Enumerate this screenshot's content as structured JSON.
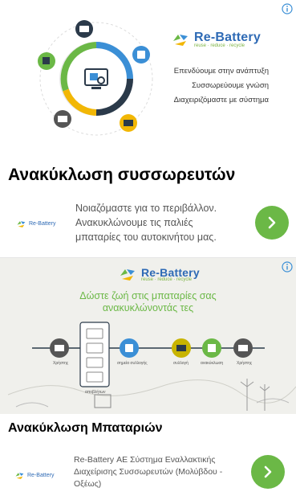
{
  "ads": [
    {
      "brand": {
        "name": "Re-Battery",
        "tagline": "reuse · reduce · recycle"
      },
      "creative_lines": [
        "Επενδύουμε στην ανάπτυξη",
        "Συσσωρεύουμε γνώση",
        "Διαχειριζόμαστε με σύστημα"
      ],
      "headline": "Ανακύκλωση συσσωρευτών",
      "sponsor": "Re-Battery",
      "description": "Νοιαζόμαστε για το περιβάλλον. Ανακυκλώνουμε τις παλιές μπαταρίες του αυτοκινήτου μας.",
      "cta_icon": "chevron-right-icon"
    },
    {
      "brand": {
        "name": "Re-Battery",
        "tagline": "reuse · reduce · recycle"
      },
      "creative_headline_1": "Δώστε ζωή στις μπαταρίες σας",
      "creative_headline_2": "ανακυκλώνοντάς τες",
      "flow_labels": [
        "Χρήστης",
        "σημεία συλλογής",
        "συλλογή",
        "ανακύκλωση",
        "Χρήστης",
        "αποβλήτων"
      ],
      "headline": "Ανακύκλωση Μπαταριών",
      "sponsor": "Re-Battery",
      "description": "Re-Battery ΑΕ Σύστημα Εναλλακτικής Διαχείρισης Συσσωρευτών (Μολύβδου - Οξέως)",
      "cta_icon": "chevron-right-icon"
    }
  ],
  "colors": {
    "brand_blue": "#2e6ab5",
    "brand_green": "#6bb846",
    "info_blue": "#3b8fd6"
  }
}
